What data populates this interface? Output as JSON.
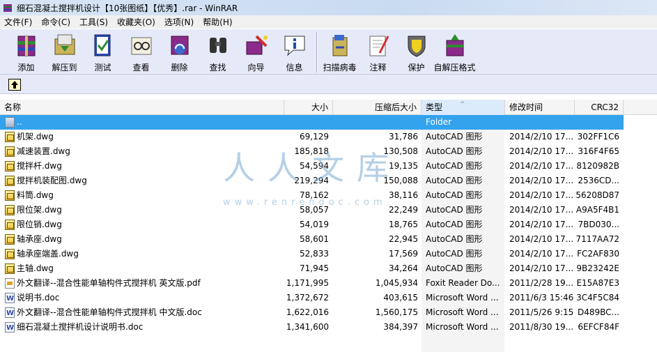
{
  "window": {
    "title": "细石混凝土搅拌机设计【10张图纸】【优秀】.rar - WinRAR"
  },
  "menu": [
    {
      "label": "文件(F)"
    },
    {
      "label": "命令(C)"
    },
    {
      "label": "工具(S)"
    },
    {
      "label": "收藏夹(O)"
    },
    {
      "label": "选项(N)"
    },
    {
      "label": "帮助(H)"
    }
  ],
  "toolbar": {
    "buttons": [
      {
        "label": "添加",
        "icon": "add-archive-icon"
      },
      {
        "label": "解压到",
        "icon": "extract-to-icon"
      },
      {
        "label": "测试",
        "icon": "test-icon"
      },
      {
        "label": "查看",
        "icon": "view-icon"
      },
      {
        "label": "删除",
        "icon": "delete-icon"
      },
      {
        "label": "查找",
        "icon": "find-icon"
      },
      {
        "label": "向导",
        "icon": "wizard-icon"
      },
      {
        "label": "信息",
        "icon": "info-icon"
      },
      {
        "label": "扫描病毒",
        "icon": "virus-scan-icon"
      },
      {
        "label": "注释",
        "icon": "comment-icon"
      },
      {
        "label": "保护",
        "icon": "protect-icon"
      },
      {
        "label": "自解压格式",
        "icon": "sfx-icon"
      }
    ]
  },
  "columns": {
    "name": "名称",
    "size": "大小",
    "packed": "压缩后大小",
    "type": "类型",
    "modified": "修改时间",
    "crc": "CRC32"
  },
  "files": [
    {
      "name": "..",
      "size": "",
      "packed": "",
      "type": "Folder",
      "modified": "",
      "crc": "",
      "icon": "folder-icon",
      "kind": "folder"
    },
    {
      "name": "机架.dwg",
      "size": "69,129",
      "packed": "31,786",
      "type": "AutoCAD 图形",
      "modified": "2014/2/10 17...",
      "crc": "302FF1C6",
      "icon": "dwg-file-icon",
      "kind": "dwg"
    },
    {
      "name": "减速装置.dwg",
      "size": "185,818",
      "packed": "130,508",
      "type": "AutoCAD 图形",
      "modified": "2014/2/10 17...",
      "crc": "316F4F65",
      "icon": "dwg-file-icon",
      "kind": "dwg"
    },
    {
      "name": "搅拌杆.dwg",
      "size": "54,594",
      "packed": "19,135",
      "type": "AutoCAD 图形",
      "modified": "2014/2/10 17...",
      "crc": "8120982B",
      "icon": "dwg-file-icon",
      "kind": "dwg"
    },
    {
      "name": "搅拌机装配图.dwg",
      "size": "219,294",
      "packed": "150,088",
      "type": "AutoCAD 图形",
      "modified": "2014/2/10 17...",
      "crc": "2536CD...",
      "icon": "dwg-file-icon",
      "kind": "dwg"
    },
    {
      "name": "料筒.dwg",
      "size": "78,162",
      "packed": "38,116",
      "type": "AutoCAD 图形",
      "modified": "2014/2/10 17...",
      "crc": "56208D87",
      "icon": "dwg-file-icon",
      "kind": "dwg"
    },
    {
      "name": "限位架.dwg",
      "size": "58,057",
      "packed": "22,249",
      "type": "AutoCAD 图形",
      "modified": "2014/2/10 17...",
      "crc": "A9A5F4B1",
      "icon": "dwg-file-icon",
      "kind": "dwg"
    },
    {
      "name": "限位销.dwg",
      "size": "54,019",
      "packed": "18,765",
      "type": "AutoCAD 图形",
      "modified": "2014/2/10 17...",
      "crc": "7BD030...",
      "icon": "dwg-file-icon",
      "kind": "dwg"
    },
    {
      "name": "轴承座.dwg",
      "size": "58,601",
      "packed": "22,945",
      "type": "AutoCAD 图形",
      "modified": "2014/2/10 17...",
      "crc": "7117AA72",
      "icon": "dwg-file-icon",
      "kind": "dwg"
    },
    {
      "name": "轴承座端盖.dwg",
      "size": "52,833",
      "packed": "17,569",
      "type": "AutoCAD 图形",
      "modified": "2014/2/10 17...",
      "crc": "FC2AF830",
      "icon": "dwg-file-icon",
      "kind": "dwg"
    },
    {
      "name": "主轴.dwg",
      "size": "71,945",
      "packed": "34,264",
      "type": "AutoCAD 图形",
      "modified": "2014/2/10 17...",
      "crc": "9B23242E",
      "icon": "dwg-file-icon",
      "kind": "dwg"
    },
    {
      "name": "外文翻译--混合性能单轴构件式搅拌机 英文版.pdf",
      "size": "1,171,995",
      "packed": "1,045,934",
      "type": "Foxit Reader Do...",
      "modified": "2011/2/28 19...",
      "crc": "E15A87E3",
      "icon": "pdf-file-icon",
      "kind": "pdf"
    },
    {
      "name": "说明书.doc",
      "size": "1,372,672",
      "packed": "403,615",
      "type": "Microsoft Word ...",
      "modified": "2011/6/3 15:46",
      "crc": "3C4F5C84",
      "icon": "word-doc-icon",
      "kind": "doc"
    },
    {
      "name": "外文翻译--混合性能单轴构件式搅拌机 中文版.doc",
      "size": "1,622,016",
      "packed": "1,560,175",
      "type": "Microsoft Word ...",
      "modified": "2011/5/26 9:15",
      "crc": "D489BC...",
      "icon": "word-doc-icon",
      "kind": "doc"
    },
    {
      "name": "细石混凝土搅拌机设计说明书.doc",
      "size": "1,341,600",
      "packed": "384,397",
      "type": "Microsoft Word ...",
      "modified": "2011/8/30 19...",
      "crc": "6EFCF84F",
      "icon": "word-doc-icon",
      "kind": "doc"
    }
  ],
  "watermark": {
    "text": "人人文库",
    "url": "www.renrendoc.com"
  }
}
